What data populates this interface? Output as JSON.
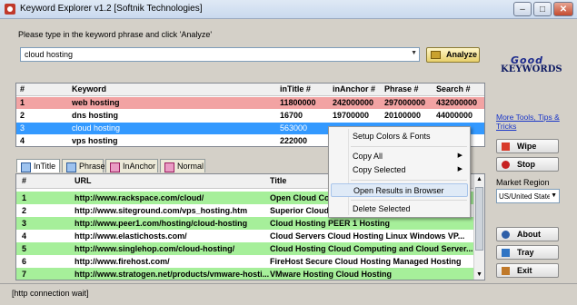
{
  "window": {
    "title": "Keyword Explorer v1.2 [Softnik Technologies]"
  },
  "search": {
    "prompt": "Please type in the keyword phrase and click 'Analyze'",
    "value": "cloud hosting",
    "analyze_label": "Analyze"
  },
  "logo": {
    "top": "Good",
    "bottom": "KEYWORDS"
  },
  "side": {
    "tools_link": "More Tools, Tips & Tricks",
    "wipe": "Wipe",
    "stop": "Stop",
    "market_label": "Market Region",
    "market_value": "US/United States",
    "about": "About",
    "tray": "Tray",
    "exit": "Exit"
  },
  "kw_table": {
    "headers": [
      "#",
      "Keyword",
      "inTitle #",
      "inAnchor #",
      "Phrase #",
      "Search #"
    ],
    "rows": [
      [
        "1",
        "web hosting",
        "11800000",
        "242000000",
        "297000000",
        "432000000"
      ],
      [
        "2",
        "dns hosting",
        "16700",
        "19700000",
        "20100000",
        "44000000"
      ],
      [
        "3",
        "cloud hosting",
        "563000",
        "",
        "",
        ""
      ],
      [
        "4",
        "vps hosting",
        "222000",
        "",
        "",
        ""
      ]
    ]
  },
  "tabs": [
    "InTitle",
    "Phrase",
    "InAnchor",
    "Normal"
  ],
  "url_table": {
    "headers": [
      "#",
      "URL",
      "Title"
    ],
    "rows": [
      [
        "1",
        "http://www.rackspace.com/cloud/",
        "Open Cloud Com"
      ],
      [
        "2",
        "http://www.siteground.com/vps_hosting.htm",
        "Superior Cloud V"
      ],
      [
        "3",
        "http://www.peer1.com/hosting/cloud-hosting",
        "Cloud Hosting PEER 1 Hosting"
      ],
      [
        "4",
        "http://www.elastichosts.com/",
        "Cloud Servers Cloud Hosting Linux Windows VP..."
      ],
      [
        "5",
        "http://www.singlehop.com/cloud-hosting/",
        "Cloud Hosting Cloud Computing and Cloud Server..."
      ],
      [
        "6",
        "http://www.firehost.com/",
        "FireHost Secure Cloud Hosting Managed Hosting"
      ],
      [
        "7",
        "http://www.stratogen.net/products/vmware-hosti...",
        "VMware Hosting Cloud Hosting"
      ]
    ]
  },
  "context_menu": {
    "setup_colors": "Setup Colors & Fonts",
    "copy_all": "Copy All",
    "copy_selected": "Copy Selected",
    "open_results": "Open Results in Browser",
    "delete_selected": "Delete Selected"
  },
  "status": "[http connection wait]",
  "colors": {
    "row_red": "#f2a3a3",
    "row_blue": "#3399ff",
    "row_green": "#a6ef9a",
    "accent_link": "#1a36c8"
  }
}
